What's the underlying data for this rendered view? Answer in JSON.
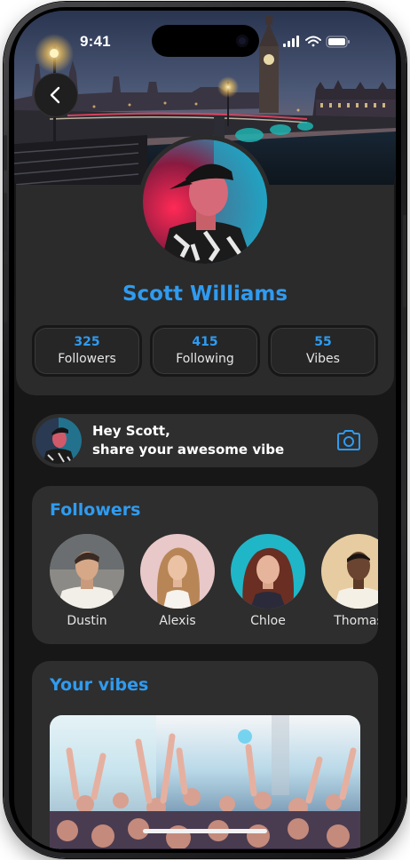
{
  "status_bar": {
    "time": "9:41"
  },
  "navigation": {
    "back_icon": "chevron-left-icon"
  },
  "profile": {
    "name": "Scott Williams",
    "stats": [
      {
        "value": "325",
        "label": "Followers"
      },
      {
        "value": "415",
        "label": "Following"
      },
      {
        "value": "55",
        "label": "Vibes"
      }
    ]
  },
  "share": {
    "line1": "Hey Scott,",
    "line2": "share your awesome vibe",
    "camera_icon": "camera-icon"
  },
  "followers": {
    "title": "Followers",
    "items": [
      {
        "name": "Dustin"
      },
      {
        "name": "Alexis"
      },
      {
        "name": "Chloe"
      },
      {
        "name": "Thomas"
      }
    ]
  },
  "vibes": {
    "title": "Your vibes"
  },
  "colors": {
    "accent": "#2f9bf0",
    "background": "#171717",
    "card": "#2e2e2e",
    "text": "#ffffff"
  }
}
